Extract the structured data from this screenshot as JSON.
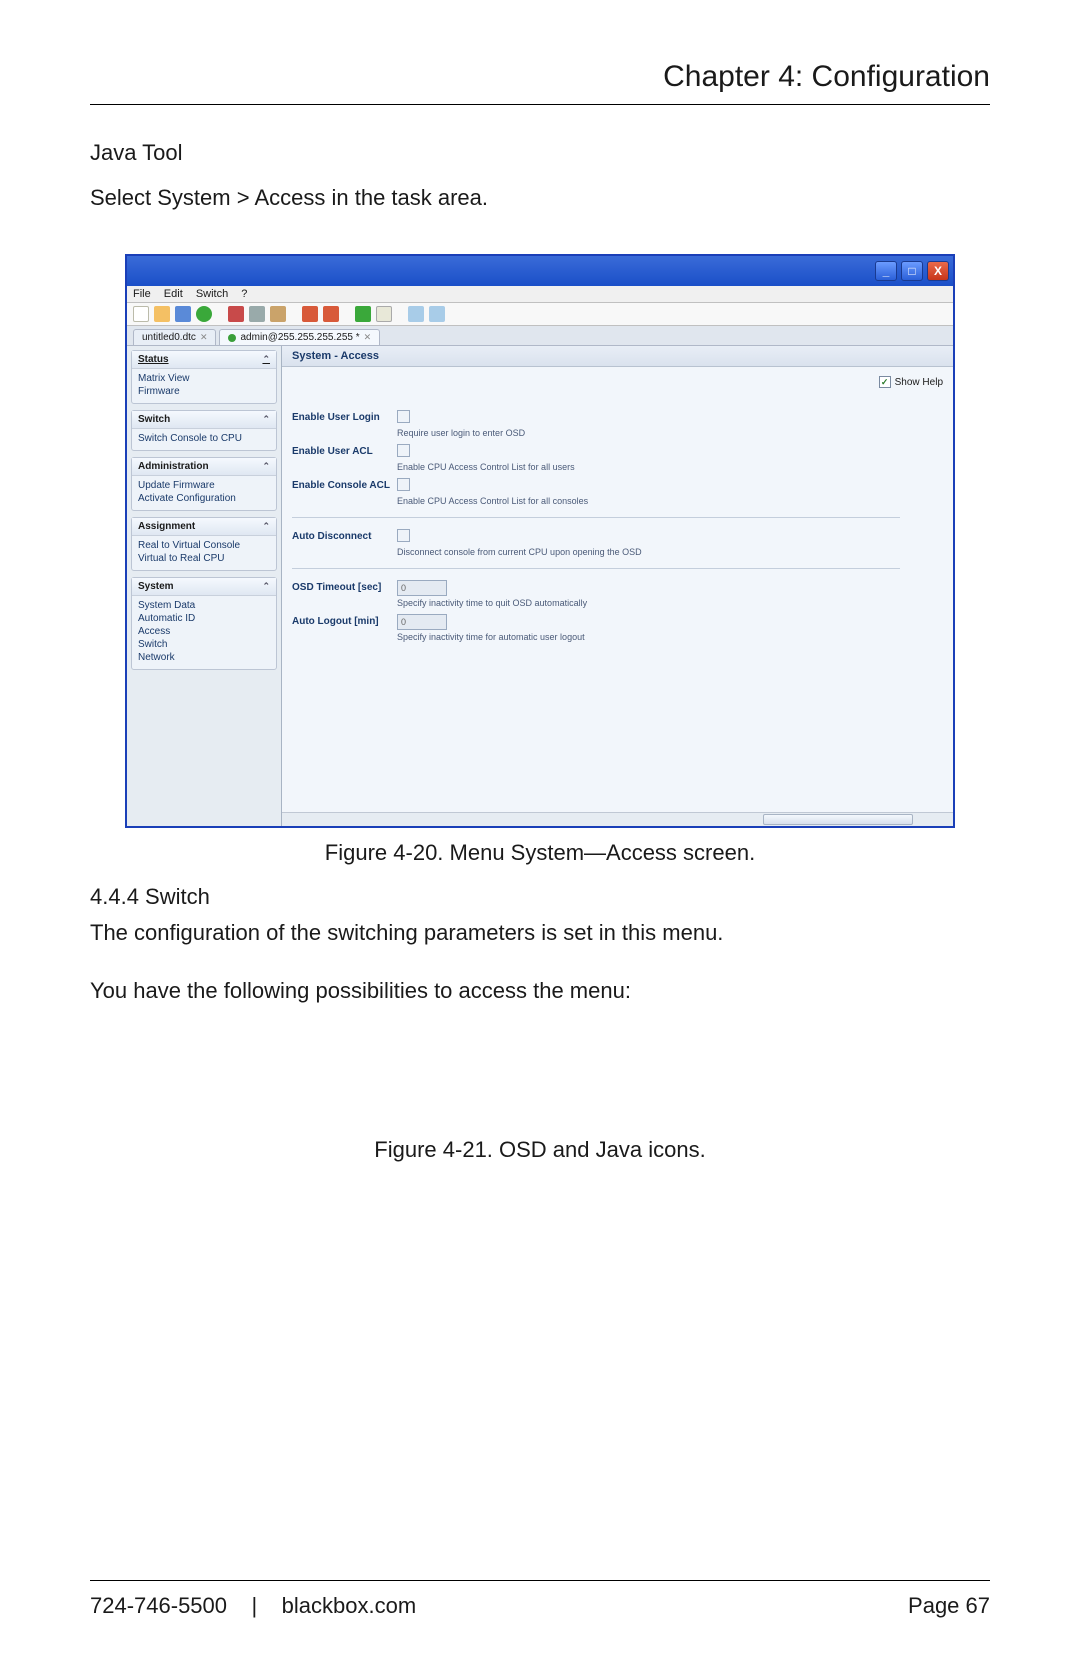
{
  "header": {
    "chapter": "Chapter 4: Configuration"
  },
  "section": {
    "javaTool": "Java Tool",
    "instruction": "Select System > Access in the task area."
  },
  "screenshot": {
    "menubar": [
      "File",
      "Edit",
      "Switch",
      "?"
    ],
    "tabs": {
      "t1": "untitled0.dtc",
      "t2": "admin@255.255.255.255 *"
    },
    "sidebar": {
      "status": {
        "title": "Status",
        "items": [
          "Matrix View",
          "Firmware"
        ]
      },
      "switch": {
        "title": "Switch",
        "items": [
          "Switch Console to CPU"
        ]
      },
      "admin": {
        "title": "Administration",
        "items": [
          "Update Firmware",
          "Activate Configuration"
        ]
      },
      "assign": {
        "title": "Assignment",
        "items": [
          "Real to Virtual Console",
          "Virtual to Real CPU"
        ]
      },
      "system": {
        "title": "System",
        "items": [
          "System Data",
          "Automatic ID",
          "Access",
          "Switch",
          "Network"
        ]
      }
    },
    "content": {
      "title": "System - Access",
      "showHelp": "Show Help",
      "rows": {
        "enableUserLogin": {
          "label": "Enable User Login",
          "help": "Require user login to enter OSD"
        },
        "enableUserACL": {
          "label": "Enable User ACL",
          "help": "Enable CPU Access Control List for all users"
        },
        "enableConsoleACL": {
          "label": "Enable Console ACL",
          "help": "Enable CPU Access Control List for all consoles"
        },
        "autoDisconnect": {
          "label": "Auto Disconnect",
          "help": "Disconnect console from current CPU upon opening the OSD"
        },
        "osdTimeout": {
          "label": "OSD Timeout [sec]",
          "value": "0",
          "help": "Specify inactivity time to quit OSD automatically"
        },
        "autoLogout": {
          "label": "Auto Logout [min]",
          "value": "0",
          "help": "Specify inactivity time for automatic user logout"
        }
      }
    }
  },
  "captions": {
    "fig20": "Figure 4-20. Menu System—Access screen.",
    "fig21": "Figure 4-21. OSD and Java icons."
  },
  "subsection": {
    "num": "4.4.4 Switch",
    "p1": "The configuration of the switching parameters is set in this menu.",
    "p2": "You have the following possibilities to access the menu:"
  },
  "footer": {
    "phone": "724-746-5500",
    "sep": "|",
    "site": "blackbox.com",
    "page": "Page 67"
  }
}
